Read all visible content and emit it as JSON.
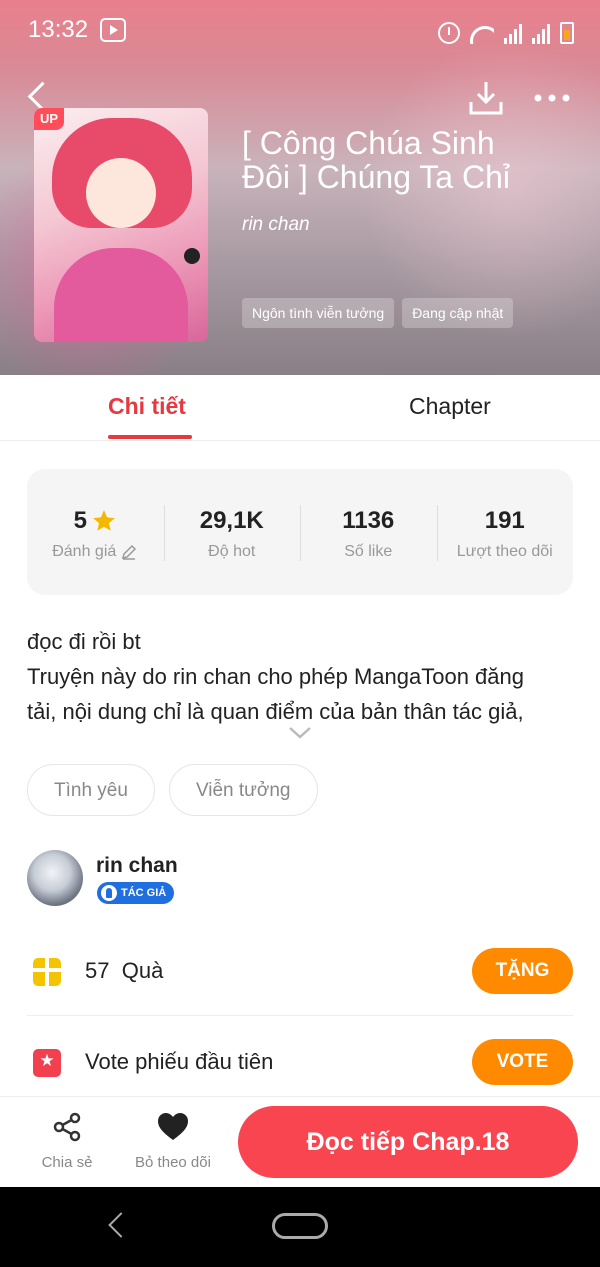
{
  "status_bar": {
    "time": "13:32"
  },
  "header": {
    "badge": "UP",
    "title": "[ Công Chúa Sinh Đôi ] Chúng Ta Chỉ",
    "author": "rin chan",
    "genres": [
      "Ngôn tình viễn tưởng",
      "Đang cập nhật"
    ]
  },
  "tabs": {
    "details": "Chi tiết",
    "chapter": "Chapter"
  },
  "stats": [
    {
      "value": "5",
      "label": "Đánh giá"
    },
    {
      "value": "29,1K",
      "label": "Độ hot"
    },
    {
      "value": "1136",
      "label": "Số like"
    },
    {
      "value": "191",
      "label": "Lượt theo dõi"
    }
  ],
  "description": {
    "line1": "đọc đi rồi bt",
    "line2": "Truyện này do rin chan cho phép MangaToon đăng",
    "line3": "tải, nội dung chỉ là quan điểm của bản thân tác giả,"
  },
  "tags": [
    "Tình yêu",
    "Viễn tưởng"
  ],
  "author_info": {
    "name": "rin chan",
    "badge": "TÁC GIẢ"
  },
  "gift": {
    "count": "57",
    "label": "Quà",
    "button": "TẶNG"
  },
  "vote": {
    "label": "Vote phiếu đầu tiên",
    "button": "VOTE"
  },
  "bottom_bar": {
    "share": "Chia sẻ",
    "unfollow": "Bỏ theo dõi",
    "read": "Đọc tiếp Chap.18"
  },
  "colors": {
    "accent": "#f84550",
    "orange": "#ff8a00",
    "star": "#f5b800"
  },
  "icons": [
    "back-icon",
    "download-icon",
    "more-icon",
    "star-icon",
    "edit-icon",
    "chevron-down-icon",
    "gift-icon",
    "vote-icon",
    "share-icon",
    "heart-icon"
  ]
}
